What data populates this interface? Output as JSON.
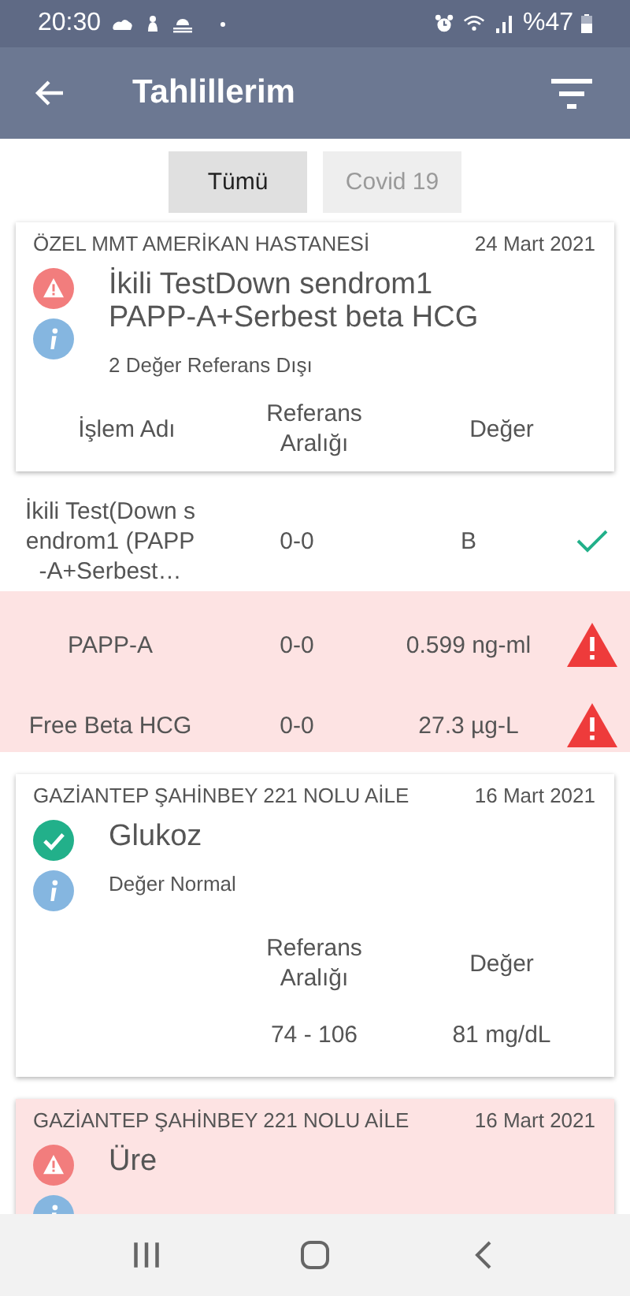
{
  "status_bar": {
    "time": "20:30",
    "battery": "%47"
  },
  "app_bar": {
    "title": "Tahlillerim"
  },
  "filters": [
    {
      "label": "Tümü",
      "selected": true
    },
    {
      "label": "Covid 19",
      "selected": false
    }
  ],
  "results": [
    {
      "kind": "panel",
      "highlighted": false,
      "out_of_range": true,
      "hospital": "ÖZEL MMT AMERİKAN HASTANESİ",
      "date": "24 Mart 2021",
      "title": "İkili TestDown sendrom1 PAPP-A+Serbest beta HCG",
      "summary": "2 Değer Referans Dışı",
      "columns": [
        "İşlem Adı",
        "Referans Aralığı",
        "Değer"
      ],
      "rows": [
        {
          "name": "İkili Test(Down sendrom1 (PAPP-A+Serbest…",
          "range": "0-0",
          "value": "B",
          "out_of_range": false
        },
        {
          "name": "PAPP-A",
          "range": "0-0",
          "value": "0.599 ng-ml",
          "out_of_range": true
        },
        {
          "name": "Free Beta HCG",
          "range": "0-0",
          "value": "27.3 µg-L",
          "out_of_range": true
        }
      ]
    },
    {
      "kind": "single",
      "highlighted": false,
      "out_of_range": false,
      "hospital": "GAZİANTEP ŞAHİNBEY 221 NOLU AİLE",
      "date": "16 Mart 2021",
      "title": "Glukoz",
      "summary": "Değer Normal",
      "columns": [
        "Referans Aralığı",
        "Değer"
      ],
      "range": "74 - 106",
      "value": "81 mg/dL"
    },
    {
      "kind": "single",
      "highlighted": true,
      "out_of_range": true,
      "hospital": "GAZİANTEP ŞAHİNBEY 221 NOLU AİLE",
      "date": "16 Mart 2021",
      "title": "Üre"
    }
  ]
}
